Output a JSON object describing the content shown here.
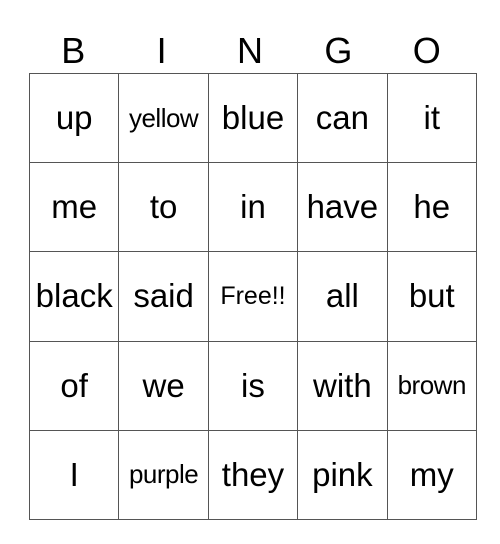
{
  "header": [
    "B",
    "I",
    "N",
    "G",
    "O"
  ],
  "rows": [
    [
      "up",
      "yellow",
      "blue",
      "can",
      "it"
    ],
    [
      "me",
      "to",
      "in",
      "have",
      "he"
    ],
    [
      "black",
      "said",
      "Free!!",
      "all",
      "but"
    ],
    [
      "of",
      "we",
      "is",
      "with",
      "brown"
    ],
    [
      "I",
      "purple",
      "they",
      "pink",
      "my"
    ]
  ]
}
